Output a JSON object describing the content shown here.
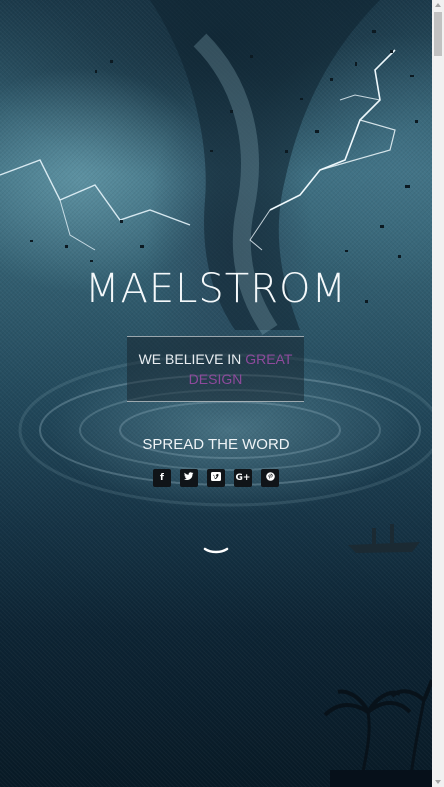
{
  "hero": {
    "title": "MAELSTROM",
    "tagline_prefix": "WE BELIEVE IN",
    "tagline_accent": "GREAT DESIGN",
    "accent_color": "#8e4a9c",
    "spread_label": "SPREAD THE WORD",
    "socials": [
      {
        "icon": "facebook-icon",
        "glyph": "f"
      },
      {
        "icon": "twitter-icon",
        "glyph": "t"
      },
      {
        "icon": "vimeo-icon",
        "glyph": "v"
      },
      {
        "icon": "google-plus-icon",
        "glyph": "G+"
      },
      {
        "icon": "pinterest-icon",
        "glyph": "P"
      }
    ],
    "scroll_icon": "chevron-down-icon"
  }
}
